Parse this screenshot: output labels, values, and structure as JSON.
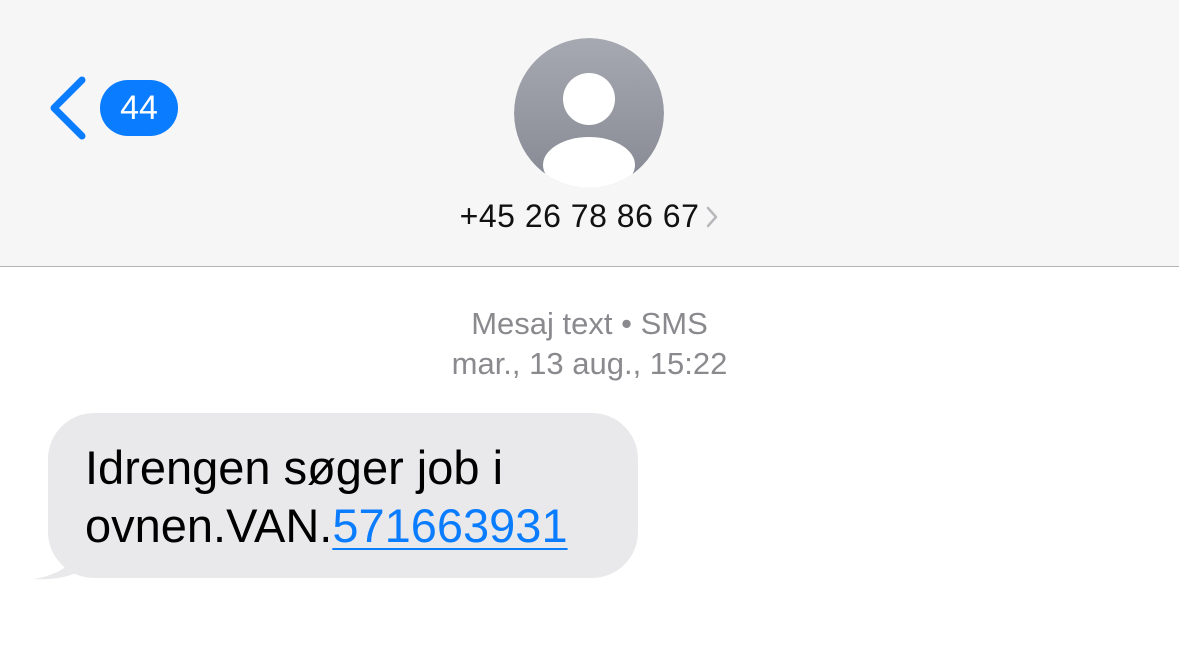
{
  "header": {
    "back": {
      "icon": "chevron-left-icon",
      "unread_count": "44",
      "accent_color": "#0a7cff"
    },
    "contact": {
      "avatar_icon": "person-placeholder-icon",
      "name": "+45 26 78 86 67",
      "disclosure_icon": "chevron-right-icon"
    }
  },
  "conversation": {
    "meta": {
      "type_label": "Mesaj text • SMS",
      "timestamp": "mar., 13 aug., 15:22"
    },
    "messages": [
      {
        "direction": "incoming",
        "line1": "Idrengen søger job i",
        "line2_text": "ovnen.VAN.",
        "line2_link": "571663931",
        "bubble_color": "#e9e9eb",
        "link_color": "#0a7cff"
      }
    ]
  }
}
